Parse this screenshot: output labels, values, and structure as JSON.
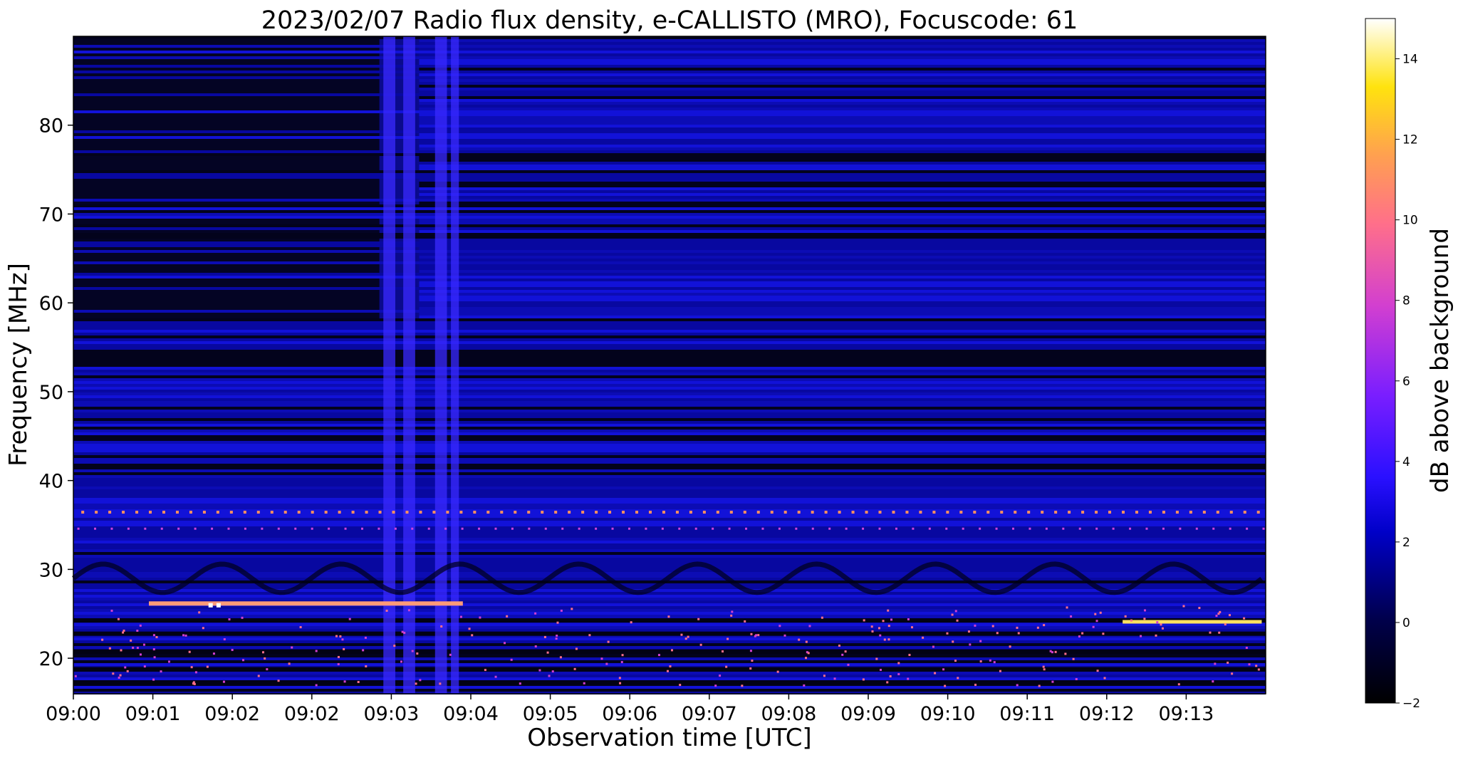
{
  "chart_data": {
    "type": "heatmap",
    "title": "2023/02/07  Radio flux density, e-CALLISTO (MRO), Focuscode: 61",
    "xlabel": "Observation time [UTC]",
    "ylabel": "Frequency [MHz]",
    "x_range_minutes": [
      0,
      15
    ],
    "xticks": [
      "09:00",
      "09:01",
      "09:02",
      "09:02",
      "09:03",
      "09:04",
      "09:05",
      "09:06",
      "09:07",
      "09:08",
      "09:09",
      "09:10",
      "09:11",
      "09:12",
      "09:13"
    ],
    "ylim": [
      16,
      90
    ],
    "yticks": [
      20,
      30,
      40,
      50,
      60,
      70,
      80
    ],
    "colorbar": {
      "label": "dB above background",
      "range": [
        -2,
        15
      ],
      "ticks": [
        -2,
        0,
        2,
        4,
        6,
        8,
        10,
        12,
        14
      ],
      "colormap": "gnuplot2"
    },
    "colors": {
      "low": "#000000",
      "mid": "#2a2aff",
      "high": "#ffff80"
    }
  }
}
